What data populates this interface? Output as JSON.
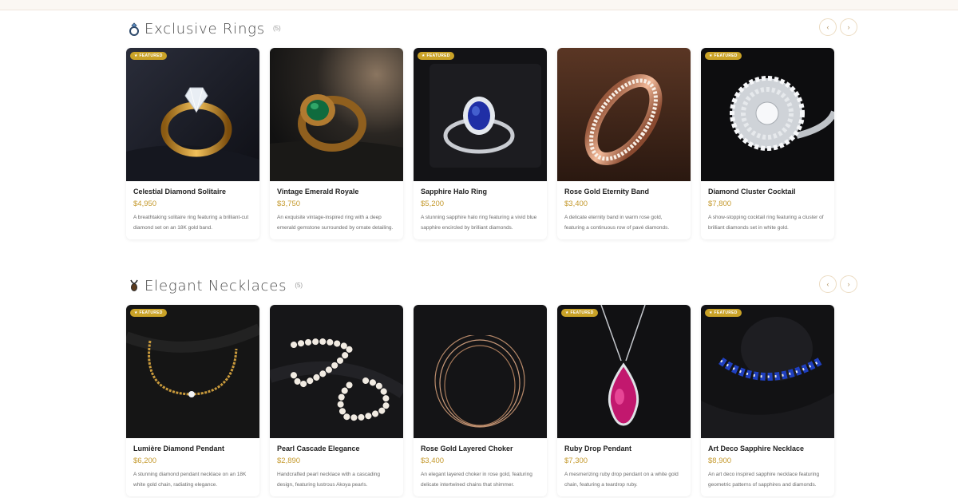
{
  "rings": {
    "title": "Exclusive Rings",
    "count": "(5)",
    "icon": "ring-icon",
    "nav_prev": "‹",
    "nav_next": "›",
    "items": [
      {
        "name": "Celestial Diamond Solitaire",
        "price": "$4,950",
        "desc": "A breathtaking solitaire ring featuring a brilliant-cut diamond set on an 18K gold band.",
        "featured": "★ FEATURED"
      },
      {
        "name": "Vintage Emerald Royale",
        "price": "$3,750",
        "desc": "An exquisite vintage-inspired ring with a deep emerald gemstone surrounded by ornate detailing.",
        "featured": ""
      },
      {
        "name": "Sapphire Halo Ring",
        "price": "$5,200",
        "desc": "A stunning sapphire halo ring featuring a vivid blue sapphire encircled by brilliant diamonds.",
        "featured": "★ FEATURED"
      },
      {
        "name": "Rose Gold Eternity Band",
        "price": "$3,400",
        "desc": "A delicate eternity band in warm rose gold, featuring a continuous row of pavé diamonds.",
        "featured": ""
      },
      {
        "name": "Diamond Cluster Cocktail",
        "price": "$7,800",
        "desc": "A show-stopping cocktail ring featuring a cluster of brilliant diamonds set in white gold.",
        "featured": "★ FEATURED"
      }
    ]
  },
  "necklaces": {
    "title": "Elegant Necklaces",
    "count": "(5)",
    "icon": "necklace-icon",
    "nav_prev": "‹",
    "nav_next": "›",
    "items": [
      {
        "name": "Lumière Diamond Pendant",
        "price": "$6,200",
        "desc": "A stunning diamond pendant necklace on an 18K white gold chain, radiating elegance.",
        "featured": "★ FEATURED"
      },
      {
        "name": "Pearl Cascade Elegance",
        "price": "$2,890",
        "desc": "Handcrafted pearl necklace with a cascading design, featuring lustrous Akoya pearls.",
        "featured": ""
      },
      {
        "name": "Rose Gold Layered Choker",
        "price": "$3,400",
        "desc": "An elegant layered choker in rose gold, featuring delicate intertwined chains that shimmer.",
        "featured": ""
      },
      {
        "name": "Ruby Drop Pendant",
        "price": "$7,300",
        "desc": "A mesmerizing ruby drop pendant on a white gold chain, featuring a teardrop ruby.",
        "featured": "★ FEATURED"
      },
      {
        "name": "Art Deco Sapphire Necklace",
        "price": "$8,900",
        "desc": "An art deco inspired sapphire necklace featuring geometric patterns of sapphires and diamonds.",
        "featured": "★ FEATURED"
      }
    ]
  }
}
